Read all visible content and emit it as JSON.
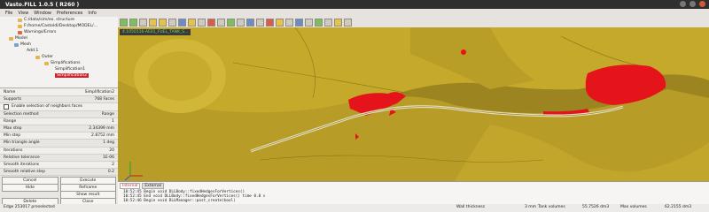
{
  "window": {
    "title": "Vasto.FILL 1.0.5 ( R260 )"
  },
  "menu": [
    "File",
    "View",
    "Window",
    "Preferences",
    "Info"
  ],
  "tree": {
    "items": [
      {
        "label": "C:/data/sim/ex. structure"
      },
      {
        "label": "F:/home/Castoldi/Desktop/MODEL/..."
      },
      {
        "label": "Warnings/Errors"
      },
      {
        "label": "Model"
      },
      {
        "label": "Mesh"
      },
      {
        "label": "Add.1"
      },
      {
        "label": "Outer"
      },
      {
        "label": "Simplifications"
      },
      {
        "label": "Simplification1"
      },
      {
        "label": "Simplification2"
      }
    ]
  },
  "properties": {
    "rows": [
      {
        "label": "Name",
        "value": "Simplification2"
      },
      {
        "label": "Supports",
        "value": "768 Faces"
      },
      {
        "label": "Enable selection of neighbors faces",
        "value": ""
      },
      {
        "label": "Selection method",
        "value": "Range"
      },
      {
        "label": "Range",
        "value": "1"
      },
      {
        "label": "Max step",
        "value": "2.34399 mm"
      },
      {
        "label": "Min step",
        "value": "2.8752 mm"
      },
      {
        "label": "Min triangle angle",
        "value": "1 deg"
      },
      {
        "label": "Iterations",
        "value": "20"
      },
      {
        "label": "Relative tolerance",
        "value": "1E-06"
      },
      {
        "label": "Smooth iterations",
        "value": "2"
      },
      {
        "label": "Smooth relative step",
        "value": "0.2"
      }
    ],
    "buttons_row1": [
      "Cancel",
      "Execute"
    ],
    "buttons_row2": [
      "Hide",
      "Refname"
    ],
    "buttons_row3": [
      "",
      "Show result"
    ],
    "buttons_row4": [
      "Delete",
      "Close"
    ]
  },
  "viewport": {
    "tab_label": "4.1050116-AE01_FUEL_TANK_S..."
  },
  "log": {
    "tabs": [
      "Internal",
      "External"
    ],
    "lines": [
      "10:52:45     Begin void DLLBody::fixedHedgesForVertices()",
      "10:52:45     End void DLLBody::fixedHedgesForVertices()  time 0.0 s",
      "10:52:46     Begin void DLLManager::post_create(bool)"
    ]
  },
  "status": {
    "left": "Edge 253017 preselected",
    "mid": "Wall thickness",
    "unit": "3 mm",
    "tank_vol_label": "Tank volumes",
    "tank_vol": "55.7526 dm3",
    "max_vol_label": "Max volumes",
    "max_vol": "62.2155 dm3"
  },
  "colors": {
    "model": "#c4a92b",
    "selection": "#e4141a",
    "viewport_bg": "#9c8520"
  }
}
